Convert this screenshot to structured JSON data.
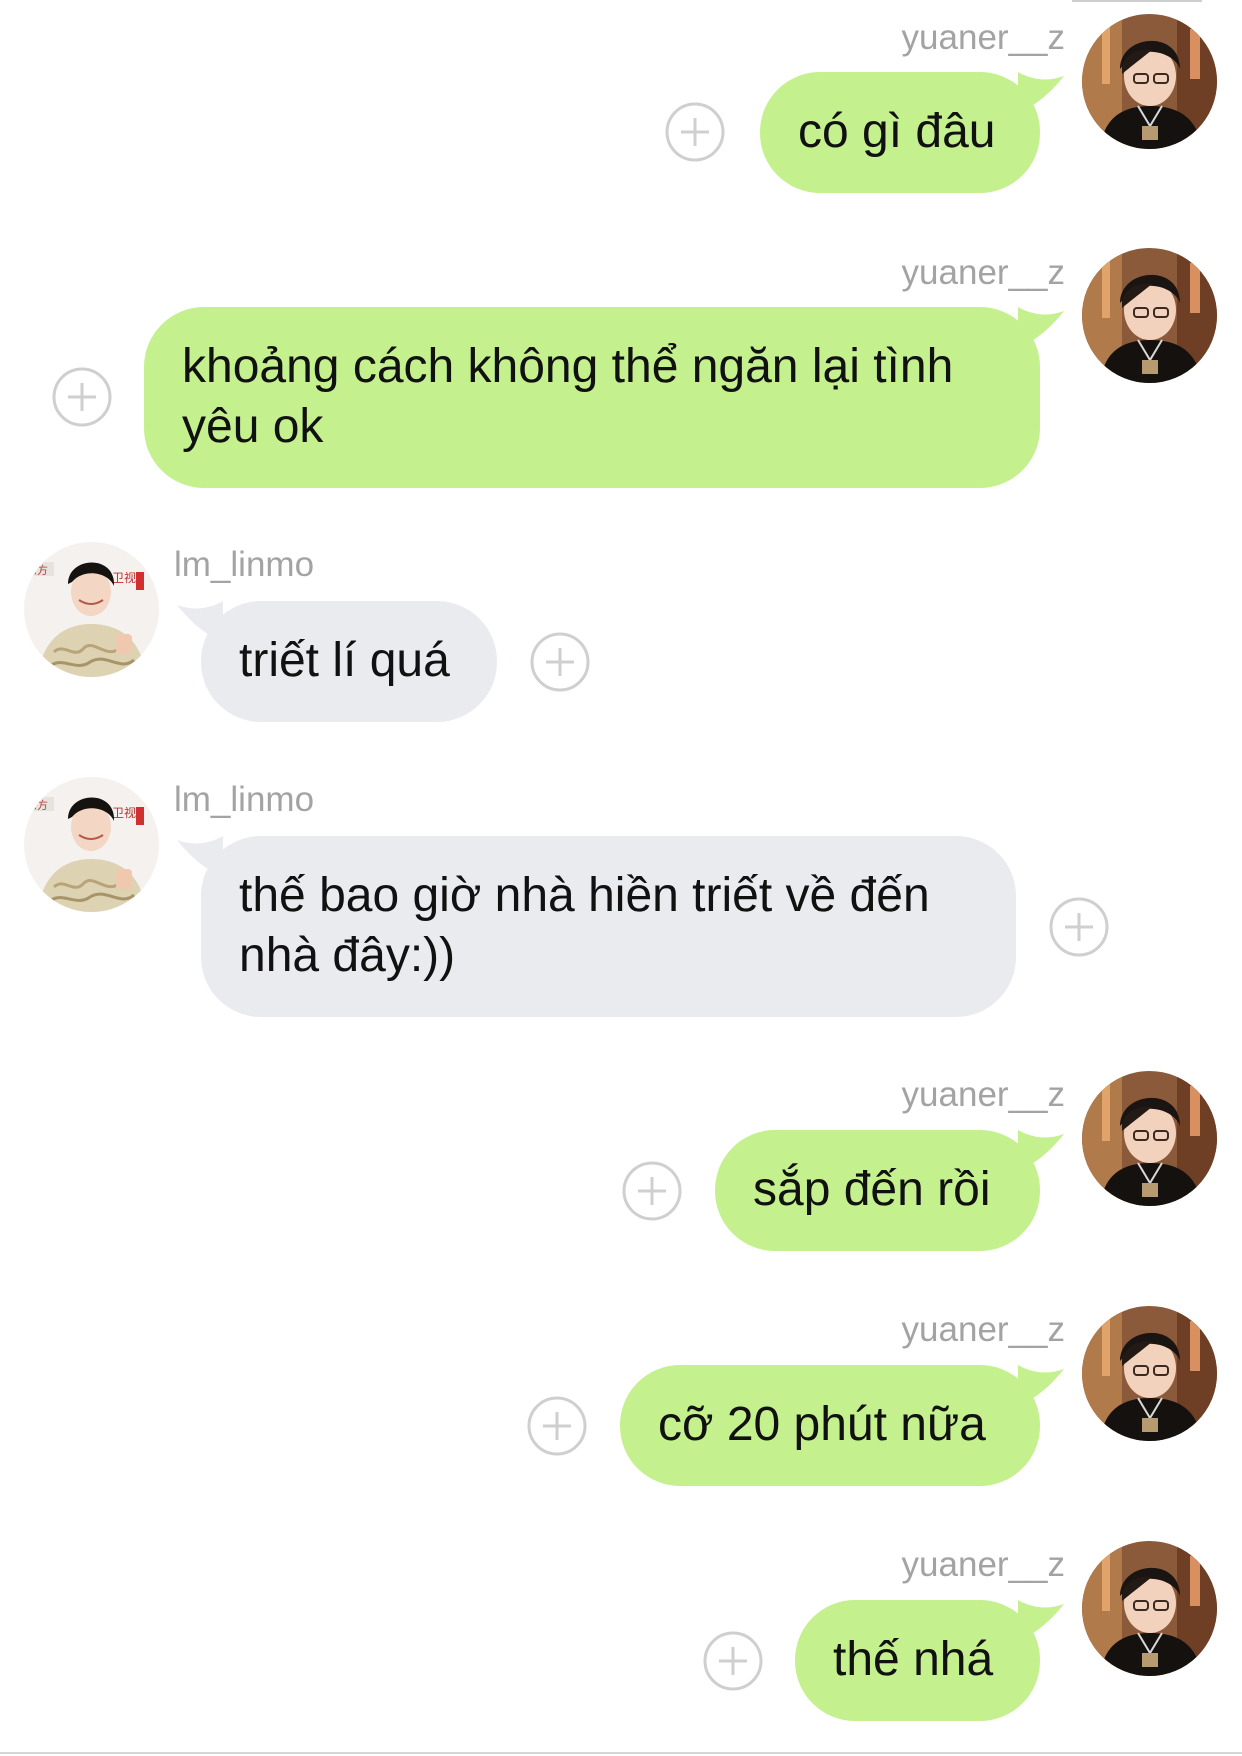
{
  "colors": {
    "sent_bubble": "#c4f08e",
    "received_bubble": "#e9ebee",
    "username_text": "#a3a3a3",
    "message_text": "#111111",
    "add_icon_stroke": "#cfcfcf"
  },
  "icons": {
    "add_reaction": "plus-circle-icon",
    "avatar_sent": "avatar-yuaner-photo",
    "avatar_received": "avatar-lm-linmo-photo"
  },
  "messages": [
    {
      "direction": "sent",
      "username": "yuaner__z",
      "lines": [
        "có gì đâu"
      ]
    },
    {
      "direction": "sent",
      "username": "yuaner__z",
      "lines": [
        "khoảng cách không thể ngăn lại tình",
        "yêu ok"
      ]
    },
    {
      "direction": "received",
      "username": "lm_linmo",
      "lines": [
        "triết lí quá"
      ]
    },
    {
      "direction": "received",
      "username": "lm_linmo",
      "lines": [
        "thế bao giờ nhà hiền triết về đến",
        "nhà đây:))"
      ]
    },
    {
      "direction": "sent",
      "username": "yuaner__z",
      "lines": [
        "sắp đến rồi"
      ]
    },
    {
      "direction": "sent",
      "username": "yuaner__z",
      "lines": [
        "cỡ 20 phút nữa"
      ]
    },
    {
      "direction": "sent",
      "username": "yuaner__z",
      "lines": [
        "thế nhá"
      ]
    }
  ]
}
